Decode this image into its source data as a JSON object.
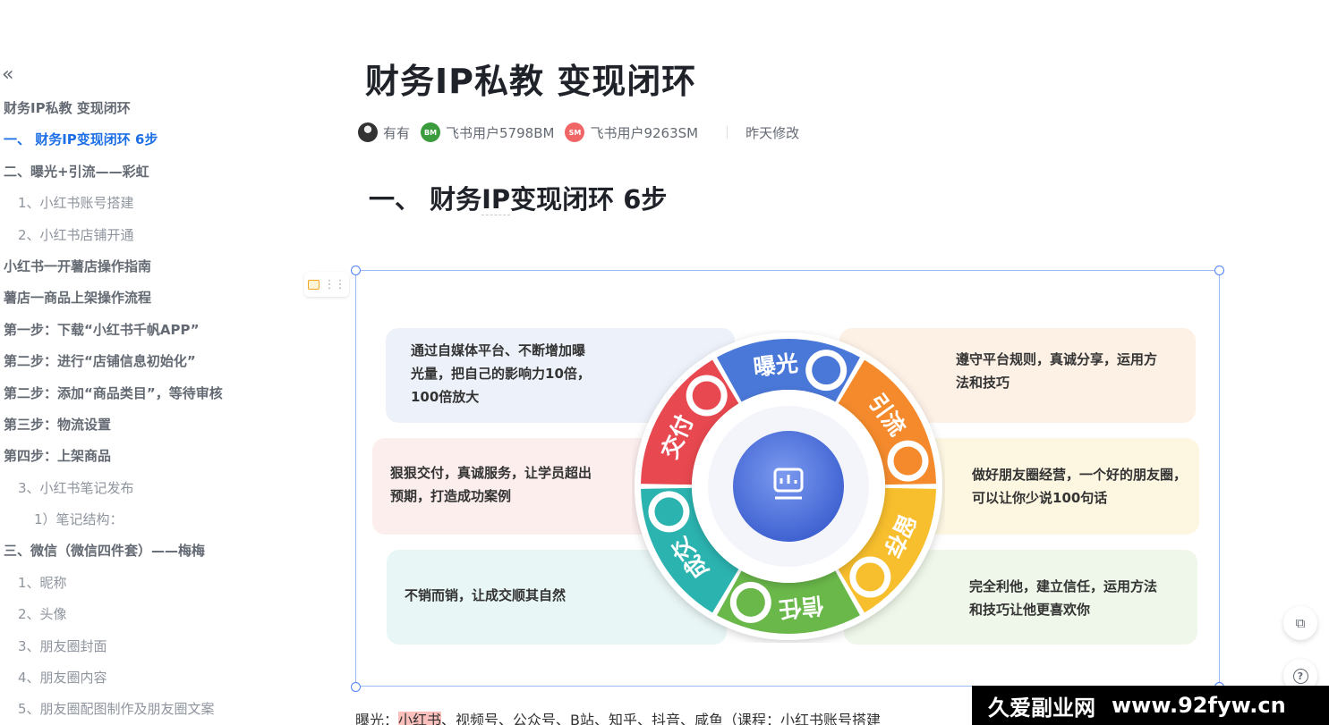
{
  "outline": {
    "collapse_glyph": "«",
    "items": [
      {
        "label": "财务IP私教 变现闭环",
        "level": 1,
        "active": false
      },
      {
        "label": "一、 财务IP变现闭环 6步",
        "level": 1,
        "active": true
      },
      {
        "label": "二、曝光+引流——彩虹",
        "level": 1,
        "active": false
      },
      {
        "label": "1、小红书账号搭建",
        "level": 2,
        "active": false
      },
      {
        "label": "2、小红书店铺开通",
        "level": 2,
        "active": false
      },
      {
        "label": "小红书一开薯店操作指南",
        "level": 1,
        "active": false
      },
      {
        "label": "薯店一商品上架操作流程",
        "level": 1,
        "active": false
      },
      {
        "label": "第一步：下载“小红书千帆APP”",
        "level": 1,
        "active": false
      },
      {
        "label": "第二步：进行“店铺信息初始化”",
        "level": 1,
        "active": false
      },
      {
        "label": "第二步：添加“商品类目”，等待审核",
        "level": 1,
        "active": false
      },
      {
        "label": "第三步：物流设置",
        "level": 1,
        "active": false
      },
      {
        "label": "第四步：上架商品",
        "level": 1,
        "active": false
      },
      {
        "label": "3、小红书笔记发布",
        "level": 2,
        "active": false
      },
      {
        "label": "1）笔记结构：",
        "level": 3,
        "active": false
      },
      {
        "label": "三、微信（微信四件套）——梅梅",
        "level": 1,
        "active": false
      },
      {
        "label": "1、昵称",
        "level": 2,
        "active": false
      },
      {
        "label": "2、头像",
        "level": 2,
        "active": false
      },
      {
        "label": "3、朋友圈封面",
        "level": 2,
        "active": false
      },
      {
        "label": "4、朋友圈内容",
        "level": 2,
        "active": false
      },
      {
        "label": "5、朋友圈配图制作及朋友圈文案",
        "level": 2,
        "active": false
      }
    ]
  },
  "doc": {
    "title": "财务IP私教  变现闭环",
    "authors": [
      {
        "name": "有有",
        "avatar_text": ""
      },
      {
        "name": "飞书用户5798BM",
        "avatar_text": "BM"
      },
      {
        "name": "飞书用户9263SM",
        "avatar_text": "SM"
      }
    ],
    "modified": "昨天修改",
    "heading_prefix": "一、 财务",
    "heading_ip": "IP",
    "heading_suffix": "变现闭环 6步"
  },
  "infographic": {
    "cards": [
      {
        "text": [
          "通过自媒体平台、不断增加曝",
          "光量，把自己的影响力10倍，",
          "100倍放大"
        ],
        "color": "#edf1f9"
      },
      {
        "text": [
          "遵守平台规则，真诚分享，运用方",
          "法和技巧"
        ],
        "color": "#fdf1e6"
      },
      {
        "text": [
          "狠狠交付，真诚服务，让学员超出",
          "预期，打造成功案例"
        ],
        "color": "#fdeeee"
      },
      {
        "text": [
          "做好朋友圈经营，一个好的朋友圈，",
          "可以让你少说100句话"
        ],
        "color": "#fdf7e2"
      },
      {
        "text": [
          "不销而销，让成交顺其自然"
        ],
        "color": "#e9f6f6"
      },
      {
        "text": [
          "完全利他，建立信任，运用方法",
          "和技巧让他更喜欢你"
        ],
        "color": "#eef7e9"
      }
    ],
    "segments": [
      {
        "label": "曝光",
        "color": "#4a78d9"
      },
      {
        "label": "引流",
        "color": "#f48a2c"
      },
      {
        "label": "留存",
        "color": "#f7be2d"
      },
      {
        "label": "信任",
        "color": "#6ab84a"
      },
      {
        "label": "成交",
        "color": "#2bb3b0"
      },
      {
        "label": "交付",
        "color": "#e8484f"
      }
    ]
  },
  "paragraph": {
    "prefix": "曝光：",
    "highlight": "小红书",
    "rest": "、视频号、公众号、B站、知乎、抖音、咸鱼（课程：小红书账号搭建"
  },
  "watermark": {
    "site_name": "久爱副业网",
    "url": "www.92fyw.cn"
  },
  "float_buttons": {
    "copy_glyph": "⧉",
    "help_glyph": "?"
  }
}
